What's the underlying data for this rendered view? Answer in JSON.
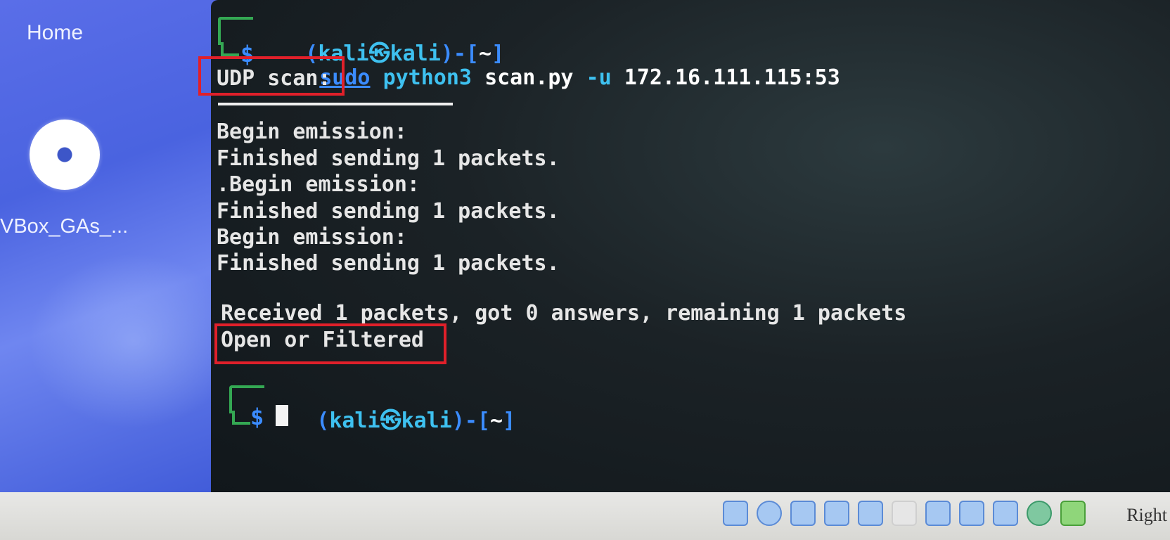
{
  "desktop": {
    "home_label": "Home",
    "cd_label": "VBox_GAs_..."
  },
  "terminal": {
    "prompt1": {
      "open": "(",
      "user": "kali",
      "sep": "㉿",
      "host": "kali",
      "close": ")-[",
      "dir": "~",
      "end": "]"
    },
    "command": {
      "sudo": "sudo",
      "python": "python3",
      "script": "scan.py",
      "flag": "-u",
      "target": "172.16.111.115:53"
    },
    "output": [
      "UDP scan:",
      "Begin emission:",
      "Finished sending 1 packets.",
      ".Begin emission:",
      "Finished sending 1 packets.",
      "Begin emission:",
      "Finished sending 1 packets.",
      "",
      "Received 1 packets, got 0 answers, remaining 1 packets",
      "Open or Filtered"
    ],
    "prompt2": {
      "open": "(",
      "user": "kali",
      "sep": "㉿",
      "host": "kali",
      "close": ")-[",
      "dir": "~",
      "end": "]"
    },
    "dollar": "$"
  },
  "statusbar": {
    "icons": [
      "hdd-icon",
      "optical-disk-icon",
      "audio-icon",
      "network-icon",
      "usb-icon",
      "shared-folder-icon",
      "display-icon",
      "recording-icon",
      "vt-x-icon",
      "guest-additions-icon",
      "mouse-integration-icon"
    ],
    "host_key": "Right"
  },
  "colors": {
    "prompt_cyan": "#3ec1f0",
    "prompt_blue": "#3b8cff",
    "frame_green": "#34a853",
    "highlight_red": "#e0202a"
  }
}
